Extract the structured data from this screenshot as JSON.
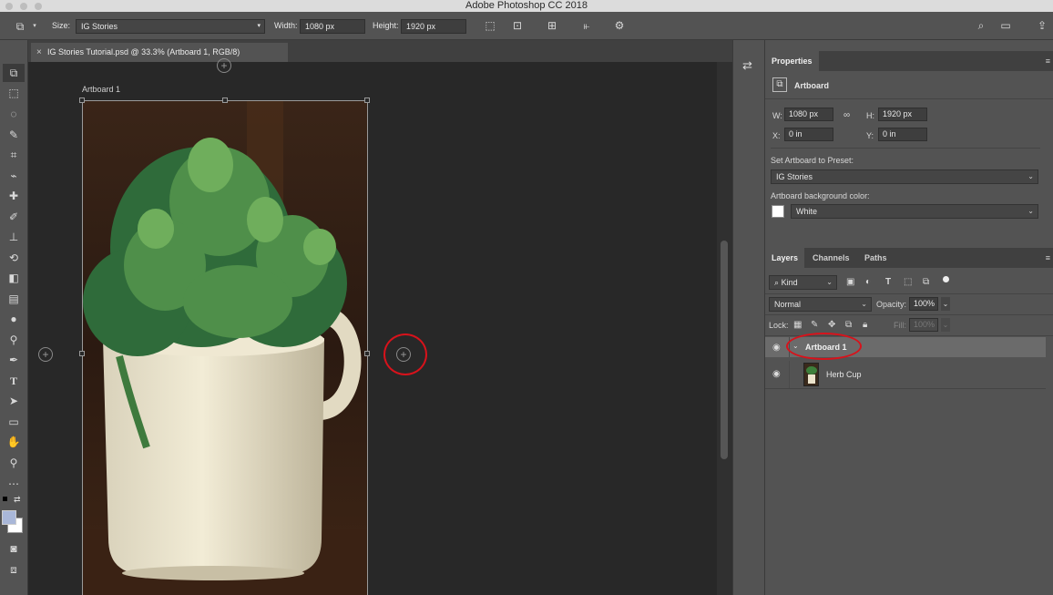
{
  "app": {
    "title": "Adobe Photoshop CC 2018"
  },
  "options_bar": {
    "size_label": "Size:",
    "size_value": "IG Stories",
    "width_label": "Width:",
    "width_value": "1080 px",
    "height_label": "Height:",
    "height_value": "1920 px"
  },
  "document": {
    "tab_title": "IG Stories Tutorial.psd @ 33.3% (Artboard 1, RGB/8)",
    "artboard_label": "Artboard 1",
    "add_artboard_glyph": "+"
  },
  "properties": {
    "tab": "Properties",
    "type_label": "Artboard",
    "w_label": "W:",
    "w_value": "1080 px",
    "h_label": "H:",
    "h_value": "1920 px",
    "x_label": "X:",
    "x_value": "0 in",
    "y_label": "Y:",
    "y_value": "0 in",
    "preset_label": "Set Artboard to Preset:",
    "preset_value": "IG Stories",
    "bg_label": "Artboard background color:",
    "bg_value": "White",
    "bg_swatch": "#ffffff"
  },
  "layers_panel": {
    "tabs": [
      "Layers",
      "Channels",
      "Paths"
    ],
    "kind_label": "Kind",
    "blend_mode": "Normal",
    "opacity_label": "Opacity:",
    "opacity_value": "100%",
    "lock_label": "Lock:",
    "fill_label": "Fill:",
    "fill_value": "100%",
    "layers": [
      {
        "name": "Artboard 1",
        "type": "artboard",
        "selected": true
      },
      {
        "name": "Herb Cup",
        "type": "image",
        "selected": false
      }
    ]
  },
  "colors": {
    "highlight_ring": "#d8121b",
    "panel_bg": "#535353",
    "canvas_bg": "#282828"
  }
}
